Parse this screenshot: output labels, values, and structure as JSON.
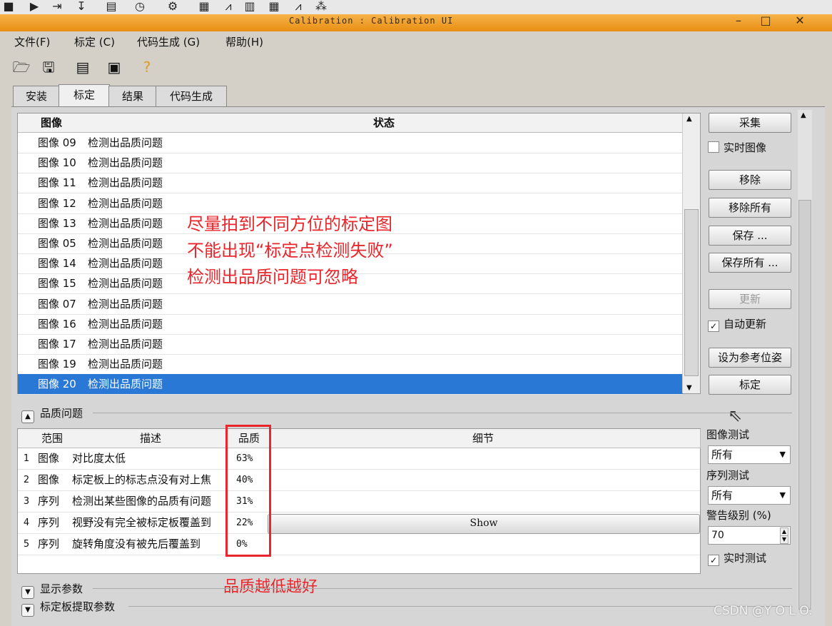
{
  "window": {
    "title": "Calibration : Calibration UI"
  },
  "menu": [
    "文件(F)",
    "标定 (C)",
    "代码生成 (G)",
    "帮助(H)"
  ],
  "tabs": [
    "安装",
    "标定",
    "结果",
    "代码生成"
  ],
  "image_list": {
    "col_image": "图像",
    "col_status": "状态",
    "rows": [
      {
        "image": "图像 09",
        "status": "检测出品质问题"
      },
      {
        "image": "图像 10",
        "status": "检测出品质问题"
      },
      {
        "image": "图像 11",
        "status": "检测出品质问题"
      },
      {
        "image": "图像 12",
        "status": "检测出品质问题"
      },
      {
        "image": "图像 13",
        "status": "检测出品质问题"
      },
      {
        "image": "图像 05",
        "status": "检测出品质问题"
      },
      {
        "image": "图像 14",
        "status": "检测出品质问题"
      },
      {
        "image": "图像 15",
        "status": "检测出品质问题"
      },
      {
        "image": "图像 07",
        "status": "检测出品质问题"
      },
      {
        "image": "图像 16",
        "status": "检测出品质问题"
      },
      {
        "image": "图像 17",
        "status": "检测出品质问题"
      },
      {
        "image": "图像 19",
        "status": "检测出品质问题"
      },
      {
        "image": "图像 20",
        "status": "检测出品质问题"
      }
    ]
  },
  "annotations": {
    "line1": "尽量拍到不同方位的标定图",
    "line2": "不能出现“标定点检测失败”",
    "line3": "检测出品质问题可忽略",
    "quality_note": "品质越低越好"
  },
  "right_panel": {
    "collect": "采集",
    "live_image": "实时图像",
    "remove": "移除",
    "remove_all": "移除所有",
    "save": "保存 ...",
    "save_all": "保存所有 ...",
    "update": "更新",
    "auto_update": "自动更新",
    "set_ref_pose": "设为参考位姿",
    "calibrate": "标定",
    "image_test_label": "图像测试",
    "image_test_value": "所有",
    "seq_test_label": "序列测试",
    "seq_test_value": "所有",
    "warn_level_label": "警告级别 (%)",
    "warn_level_value": "70",
    "live_test": "实时测试"
  },
  "quality": {
    "section": "品质问题",
    "col_scope": "范围",
    "col_desc": "描述",
    "col_quality": "品质",
    "col_detail": "细节",
    "rows": [
      {
        "n": "1",
        "scope": "图像",
        "desc": "对比度太低",
        "quality": "63%"
      },
      {
        "n": "2",
        "scope": "图像",
        "desc": "标定板上的标志点没有对上焦",
        "quality": "40%"
      },
      {
        "n": "3",
        "scope": "序列",
        "desc": "检测出某些图像的品质有问题",
        "quality": "31%"
      },
      {
        "n": "4",
        "scope": "序列",
        "desc": "视野没有完全被标定板覆盖到",
        "quality": "22%",
        "detail_button": "Show"
      },
      {
        "n": "5",
        "scope": "序列",
        "desc": "旋转角度没有被先后覆盖到",
        "quality": "0%"
      }
    ]
  },
  "sections": {
    "display_params": "显示参数",
    "plate_params": "标定板提取参数"
  },
  "watermark": "CSDN @Y O L O.",
  "colors": {
    "selection": "#2a78d6",
    "annotation_red": "#e8262b",
    "titlebar": "#f0a030"
  }
}
